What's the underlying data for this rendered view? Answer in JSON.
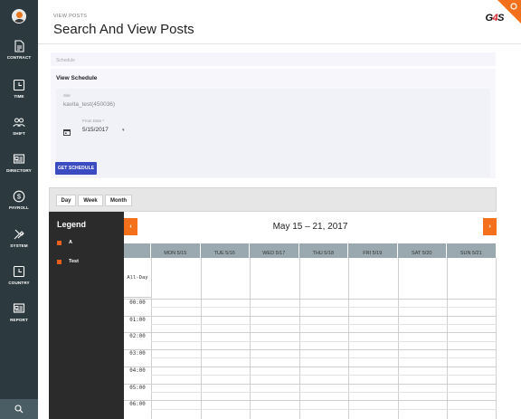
{
  "sidebar": {
    "items": [
      {
        "label": "CONTRACT",
        "icon": "document-icon"
      },
      {
        "label": "TIME",
        "icon": "clock-icon"
      },
      {
        "label": "SHIFT",
        "icon": "people-icon"
      },
      {
        "label": "DIRECTORY",
        "icon": "directory-icon"
      },
      {
        "label": "PAYROLL",
        "icon": "dollar-icon"
      },
      {
        "label": "SYSTEM",
        "icon": "tools-icon"
      },
      {
        "label": "COUNTRY",
        "icon": "clock-icon"
      },
      {
        "label": "REPORT",
        "icon": "report-icon"
      }
    ],
    "bottom_icon": "search-icon"
  },
  "header": {
    "breadcrumb": "VIEW POSTS",
    "title": "Search And View Posts",
    "logo": {
      "g": "G",
      "four": "4",
      "s": "S"
    },
    "corner_icon": "gear-icon"
  },
  "schedule_card": {
    "label": "Schedule"
  },
  "view_schedule": {
    "title": "View Schedule",
    "site_label": "Site",
    "site_value": "kavita_test(450036)",
    "from_label": "From Date *",
    "from_value": "5/15/2017",
    "get_button": "GET SCHEDULE"
  },
  "calendar": {
    "views": [
      "Day",
      "Week",
      "Month"
    ],
    "legend_title": "Legend",
    "legend_items": [
      "A",
      "Test"
    ],
    "range": "May 15 – 21, 2017",
    "prev": "‹",
    "next": "›",
    "days": [
      "MON 5/15",
      "TUE 5/16",
      "WED 5/17",
      "THU 5/18",
      "FRI 5/19",
      "SAT 5/20",
      "SUN 5/21"
    ],
    "all_day": "All-Day",
    "times": [
      "00:00",
      "01:00",
      "02:00",
      "03:00",
      "04:00",
      "05:00",
      "06:00"
    ]
  },
  "colors": {
    "sidebar": "#2c3a3f",
    "button": "#3b4bc2",
    "accent": "#f4701a",
    "legend_swatch": "#e8601c",
    "header_row": "#9aa9b0"
  }
}
